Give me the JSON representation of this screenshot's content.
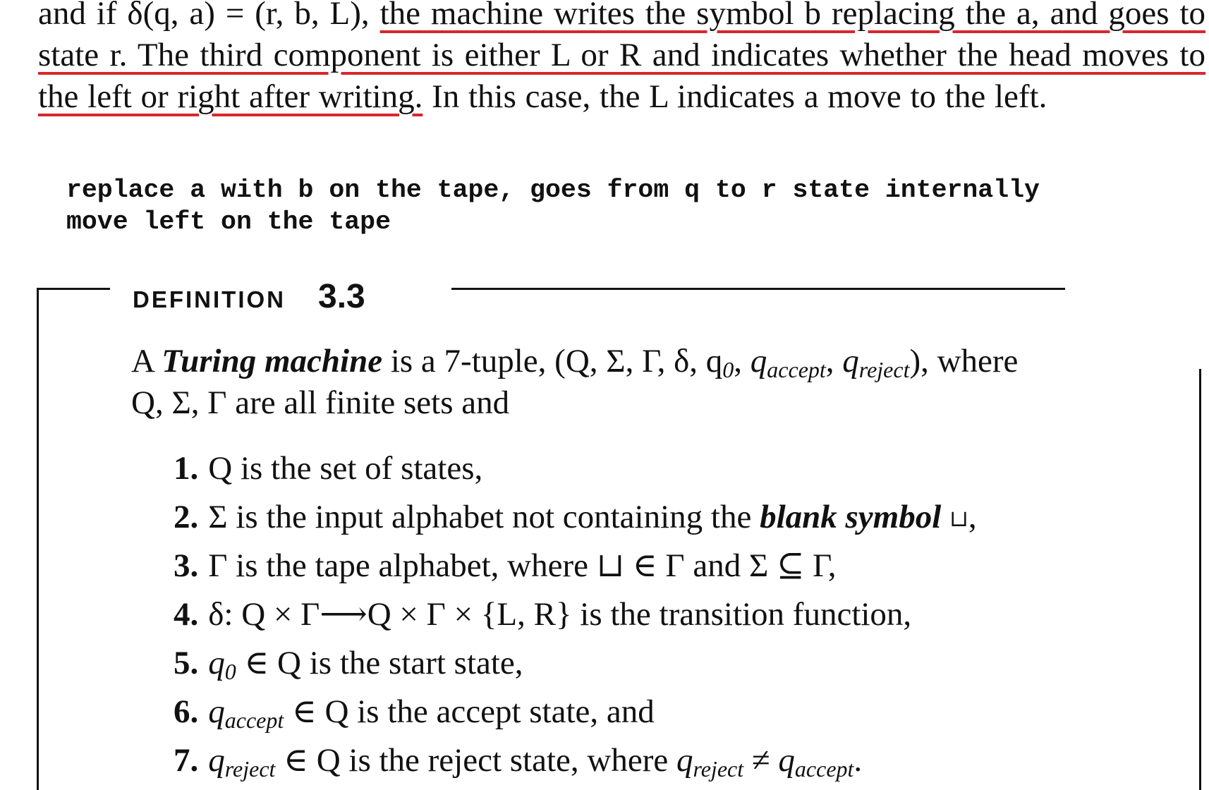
{
  "paragraph": {
    "lead": "and if δ(q, a) = (r, b, L),",
    "underlined": "the machine writes the symbol b replacing the a, and goes to state r. The third component is either L or R and indicates whether the head moves to the left or right after writing.",
    "tail": "In this case, the L indicates a move to the left."
  },
  "note": {
    "line1": "replace a with b on the tape, goes from q to r state internally",
    "line2": "move left on the tape"
  },
  "definition": {
    "label": "DEFINITION",
    "number": "3.3",
    "intro": {
      "a": "A",
      "term": "Turing machine",
      "tuple_pre": "is a 7-tuple, (Q, Σ, Γ, δ, q",
      "sub0": "0",
      "sub_accept": "accept",
      "sub_reject": "reject",
      "where": "), where",
      "line2": "Q, Σ, Γ are all finite sets and"
    },
    "items": [
      {
        "num": "1.",
        "text": "Q is the set of states,"
      },
      {
        "num": "2.",
        "text_pre": "Σ is the input alphabet not containing the",
        "term": "blank symbol",
        "blank": "⊔",
        "text_post": ","
      },
      {
        "num": "3.",
        "text": "Γ is the tape alphabet, where ⊔ ∈ Γ and Σ ⊆ Γ,"
      },
      {
        "num": "4.",
        "text": "δ: Q × Γ⟶Q × Γ × {L, R} is the transition function,"
      },
      {
        "num": "5.",
        "q": "q",
        "sub": "0",
        "text": " ∈ Q is the start state,"
      },
      {
        "num": "6.",
        "q": "q",
        "sub": "accept",
        "text": " ∈ Q is the accept state, and"
      },
      {
        "num": "7.",
        "q": "q",
        "sub": "reject",
        "text": " ∈ Q is the reject state, where ",
        "q2": "q",
        "sub2": "reject",
        "neq": " ≠ ",
        "q3": "q",
        "sub3": "accept",
        "end": "."
      }
    ]
  }
}
